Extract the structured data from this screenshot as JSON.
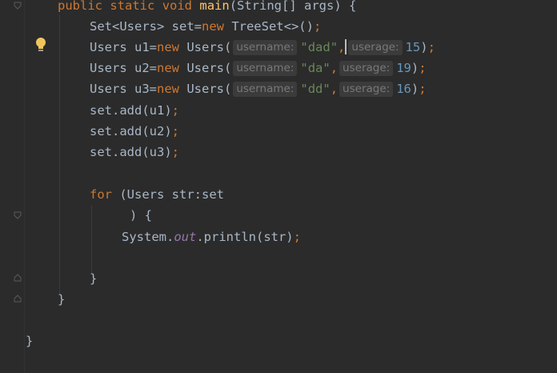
{
  "code": {
    "l1": {
      "public": "public",
      "static": "static",
      "void": "void",
      "name": "main",
      "params": "(String[] args) {"
    },
    "l2": {
      "text1": "Set<Users> set=",
      "new": "new",
      "text2": " TreeSet<>()",
      "semi": ";"
    },
    "l3": {
      "text1": "Users u1=",
      "new": "new",
      "text2": " Users(",
      "hint1": "username:",
      "str": "\"dad\"",
      "comma": ",",
      "hint2": "userage:",
      "num": "15",
      "close": ")",
      "semi": ";"
    },
    "l4": {
      "text1": "Users u2=",
      "new": "new",
      "text2": " Users(",
      "hint1": "username:",
      "str": "\"da\"",
      "comma": ",",
      "hint2": "userage:",
      "num": "19",
      "close": ")",
      "semi": ";"
    },
    "l5": {
      "text1": "Users u3=",
      "new": "new",
      "text2": " Users(",
      "hint1": "username:",
      "str": "\"dd\"",
      "comma": ",",
      "hint2": "userage:",
      "num": "16",
      "close": ")",
      "semi": ";"
    },
    "l6": {
      "text": "set.add(u1)",
      "semi": ";"
    },
    "l7": {
      "text": "set.add(u2)",
      "semi": ";"
    },
    "l8": {
      "text": "set.add(u3)",
      "semi": ";"
    },
    "l9": {
      "for": "for",
      "text": " (Users str:set"
    },
    "l10": {
      "text": ") {"
    },
    "l11": {
      "text1": "System.",
      "out": "out",
      "text2": ".println(str)",
      "semi": ";"
    },
    "l12": {
      "text": "}"
    },
    "l13": {
      "text": "}"
    },
    "l14": {
      "text": "}"
    }
  },
  "icons": {
    "intention": "lightbulb-icon",
    "fold": "fold-marker-icon"
  },
  "colors": {
    "background": "#2b2b2b",
    "keyword": "#cc7832",
    "method": "#ffc66d",
    "string": "#6a8759",
    "number": "#6897bb",
    "static_field": "#9876aa",
    "text": "#a9b7c6"
  }
}
